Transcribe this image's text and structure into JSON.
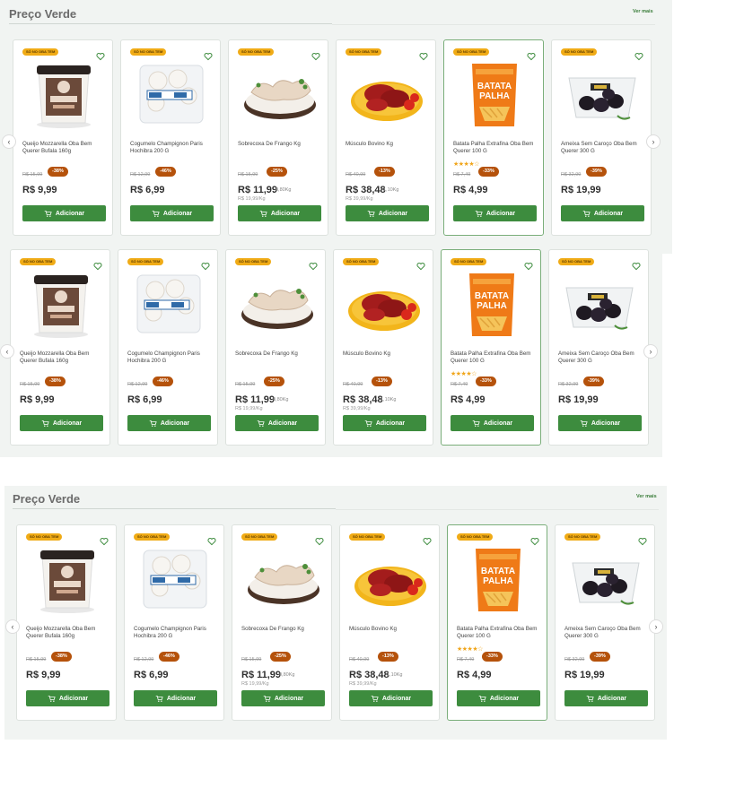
{
  "sections": [
    {
      "title": "Preço Verde",
      "see_more": "Ver mais"
    },
    {
      "title": "",
      "see_more": ""
    },
    {
      "title": "Preço Verde",
      "see_more": "Ver mais"
    }
  ],
  "nav": {
    "prev_icon": "chevron-left-icon",
    "next_icon": "chevron-right-icon",
    "prev_glyph": "‹",
    "next_glyph": "›"
  },
  "add_label": "Adicionar",
  "badge_label": "SÓ NO OBA TEM",
  "colors": {
    "brand_green": "#3d8c3e",
    "discount": "#b5520b",
    "badge": "#f0ab16",
    "star": "#f0a51a"
  },
  "products": [
    {
      "name": "Queijo Mozzarella Oba Bem Querer Bufala 160g",
      "old_price": "R$ 15,99",
      "discount": "-38%",
      "price": "R$ 9,99",
      "unit": "",
      "per_kg": "",
      "rating": "",
      "image": "cheese-jar"
    },
    {
      "name": "Cogumelo Champignon Paris Hochibra 200 G",
      "old_price": "R$ 12,99",
      "discount": "-46%",
      "price": "R$ 6,99",
      "unit": "",
      "per_kg": "",
      "rating": "",
      "image": "mushroom-tray"
    },
    {
      "name": "Sobrecoxa De Frango Kg",
      "old_price": "R$ 15,99",
      "discount": "-25%",
      "price": "R$ 11,99",
      "unit": "0,80Kg",
      "per_kg": "R$ 19,99/Kg",
      "rating": "",
      "image": "chicken"
    },
    {
      "name": "Músculo Bovino Kg",
      "old_price": "R$ 40,99",
      "discount": "-13%",
      "price": "R$ 38,48",
      "unit": "1,10Kg",
      "per_kg": "R$ 39,99/Kg",
      "rating": "",
      "image": "beef"
    },
    {
      "name": "Batata Palha Extrafina Oba Bem Querer 100 G",
      "old_price": "R$ 7,49",
      "discount": "-33%",
      "price": "R$ 4,99",
      "unit": "",
      "per_kg": "",
      "rating": "★★★★☆",
      "image": "potato-bag"
    },
    {
      "name": "Ameixa Sem Caroço Oba Bem Querer 300 G",
      "old_price": "R$ 32,99",
      "discount": "-39%",
      "price": "R$ 19,99",
      "unit": "",
      "per_kg": "",
      "rating": "",
      "image": "plums"
    }
  ]
}
